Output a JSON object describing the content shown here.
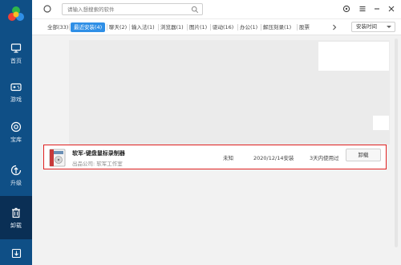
{
  "sidebar": {
    "items": [
      {
        "label": "首页",
        "icon": "home-monitor-icon"
      },
      {
        "label": "游戏",
        "icon": "gamepad-icon"
      },
      {
        "label": "宝库",
        "icon": "treasure-disc-icon"
      },
      {
        "label": "升级",
        "icon": "upgrade-arrow-icon"
      },
      {
        "label": "卸载",
        "icon": "trash-icon"
      }
    ],
    "bottom_icon": "download-icon"
  },
  "search": {
    "placeholder": "请输入想搜索的软件"
  },
  "tabs": [
    {
      "label": "全部(33)"
    },
    {
      "label": "最近安装(4)"
    },
    {
      "label": "聊天(2)"
    },
    {
      "label": "输入法(1)"
    },
    {
      "label": "浏览器(1)"
    },
    {
      "label": "图片(1)"
    },
    {
      "label": "驱动(16)"
    },
    {
      "label": "办公(1)"
    },
    {
      "label": "解压刻录(1)"
    },
    {
      "label": "股票"
    }
  ],
  "sort": {
    "label": "安装时间"
  },
  "app": {
    "name": "软军-键盘鼠标录制器",
    "publisher": "出品公司: 软军工作室",
    "size": "未知",
    "install_date": "2020/12/14安装",
    "usage": "3天内使用过",
    "uninstall_label": "卸载"
  },
  "colors": {
    "sidebar": "#0f4f86",
    "sidebar_active": "#0a2f55",
    "tab_active": "#2f8fe6",
    "highlight_border": "#e02020"
  }
}
